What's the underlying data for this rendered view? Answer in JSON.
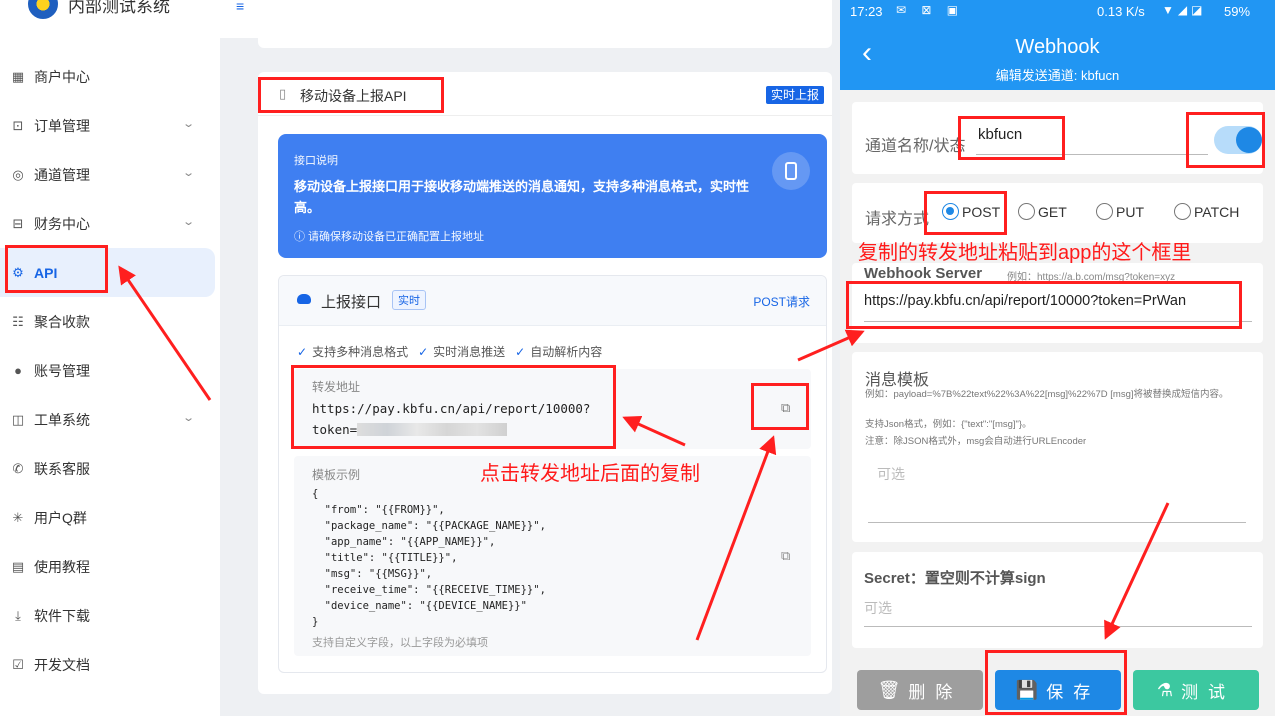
{
  "app": {
    "title": "内部测试系统"
  },
  "sidebar": {
    "items": [
      {
        "label": "商户中心",
        "icon": "grid-icon",
        "glyph": "▦",
        "chevron": false
      },
      {
        "label": "订单管理",
        "icon": "briefcase-icon",
        "glyph": "⊡",
        "chevron": true
      },
      {
        "label": "通道管理",
        "icon": "settings-icon",
        "glyph": "◎",
        "chevron": true
      },
      {
        "label": "财务中心",
        "icon": "wallet-icon",
        "glyph": "⊟",
        "chevron": true
      },
      {
        "label": "API",
        "icon": "chip-icon",
        "glyph": "⚙",
        "chevron": false,
        "active": true
      },
      {
        "label": "聚合收款",
        "icon": "coins-icon",
        "glyph": "☷",
        "chevron": false
      },
      {
        "label": "账号管理",
        "icon": "user-icon",
        "glyph": "●",
        "chevron": false
      },
      {
        "label": "工单系统",
        "icon": "book-icon",
        "glyph": "◫",
        "chevron": true
      },
      {
        "label": "联系客服",
        "icon": "phone-icon",
        "glyph": "✆",
        "chevron": false
      },
      {
        "label": "用户Q群",
        "icon": "spinner-icon",
        "glyph": "✳",
        "chevron": false
      },
      {
        "label": "使用教程",
        "icon": "document-icon",
        "glyph": "▤",
        "chevron": false
      },
      {
        "label": "软件下载",
        "icon": "download-icon",
        "glyph": "⤓",
        "chevron": false
      },
      {
        "label": "开发文档",
        "icon": "doc-check-icon",
        "glyph": "☑",
        "chevron": false
      }
    ]
  },
  "main": {
    "card_title": "移动设备上报API",
    "badge": "实时上报",
    "info": {
      "label": "接口说明",
      "description": "移动设备上报接口用于接收移动端推送的消息通知，支持多种消息格式，实时性高。",
      "note": "ⓘ 请确保移动设备已正确配置上报地址"
    },
    "api": {
      "title": "上报接口",
      "tag": "实时",
      "method": "POST请求",
      "features": [
        "支持多种消息格式",
        "实时消息推送",
        "自动解析内容"
      ],
      "url_label": "转发地址",
      "url_value": "https://pay.kbfu.cn/api/report/10000?token=",
      "template_label": "模板示例",
      "template_code": "{\n  \"from\": \"{{FROM}}\",\n  \"package_name\": \"{{PACKAGE_NAME}}\",\n  \"app_name\": \"{{APP_NAME}}\",\n  \"title\": \"{{TITLE}}\",\n  \"msg\": \"{{MSG}}\",\n  \"receive_time\": \"{{RECEIVE_TIME}}\",\n  \"device_name\": \"{{DEVICE_NAME}}\"\n}",
      "template_note": "支持自定义字段，以上字段为必填项"
    }
  },
  "phone": {
    "status": {
      "time": "17:23",
      "speed": "0.13 K/s",
      "battery": "59%"
    },
    "title": "Webhook",
    "subtitle": "编辑发送通道: kbfucn",
    "name_label": "通道名称/状态",
    "name_value": "kbfucn",
    "method_label": "请求方式",
    "methods": [
      "POST",
      "GET",
      "PUT",
      "PATCH"
    ],
    "selected_method": "POST",
    "server_label": "Webhook Server",
    "server_example": "例如：https://a.b.com/msg?token=xyz",
    "server_value": "https://pay.kbfu.cn/api/report/10000?token=PrWan",
    "template_title": "消息模板",
    "template_hints": [
      "例如：payload=%7B%22text%22%3A%22[msg]%22%7D [msg]将被替换成短信内容。",
      "支持Json格式，例如：{\"text\":\"[msg]\"}。",
      "注意：除JSON格式外，msg会自动进行URLEncoder"
    ],
    "template_placeholder": "可选",
    "secret_label": "Secret：置空则不计算sign",
    "secret_placeholder": "可选",
    "buttons": {
      "delete": "删除",
      "save": "保存",
      "test": "测试"
    }
  },
  "annotations": {
    "paste_hint": "复制的转发地址粘贴到app的这个框里",
    "copy_hint": "点击转发地址后面的复制",
    "color": "#ff1f1f"
  }
}
